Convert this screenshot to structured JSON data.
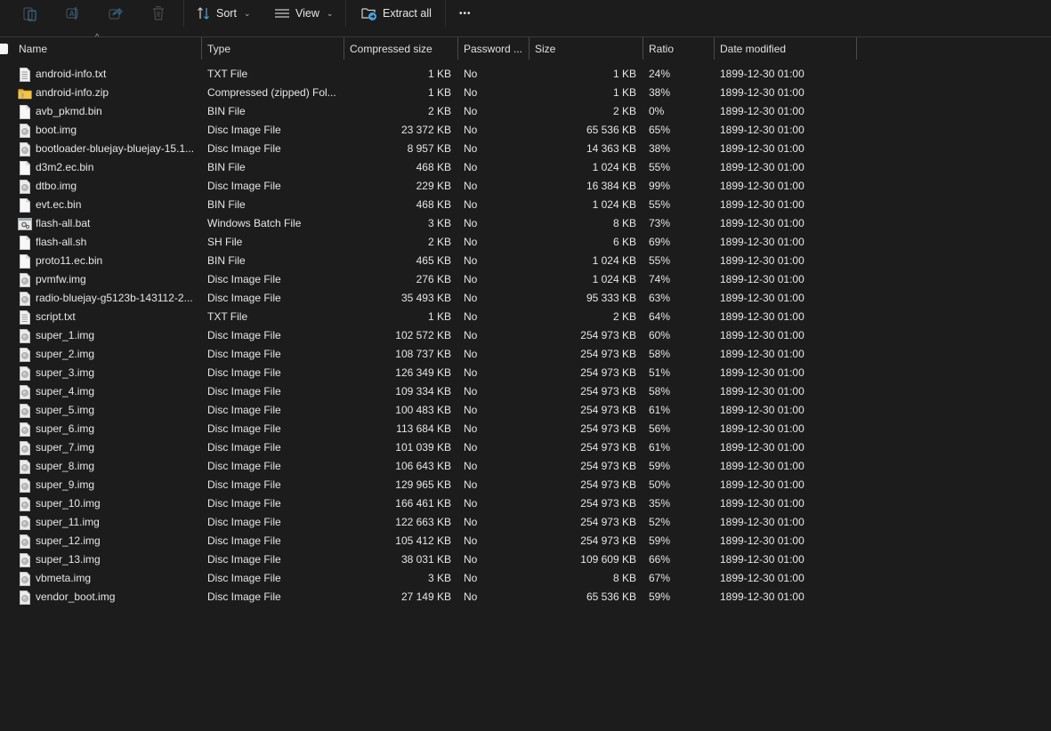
{
  "toolbar": {
    "icons": [
      {
        "name": "copy-icon",
        "label": "Copy"
      },
      {
        "name": "rename-icon",
        "label": "Rename"
      },
      {
        "name": "share-icon",
        "label": "Share"
      },
      {
        "name": "delete-icon",
        "label": "Delete"
      }
    ],
    "sort_label": "Sort",
    "view_label": "View",
    "extract_label": "Extract all",
    "more_label": "•••",
    "accent_color": "#4aa3df"
  },
  "columns": {
    "name": "Name",
    "type": "Type",
    "compressed": "Compressed size",
    "password": "Password ...",
    "size": "Size",
    "ratio": "Ratio",
    "date": "Date modified",
    "sort_indicator": "^"
  },
  "files": [
    {
      "icon": "text-file-icon",
      "name": "android-info.txt",
      "type": "TXT File",
      "compressed": "1 KB",
      "password": "No",
      "size": "1 KB",
      "ratio": "24%",
      "date": "1899-12-30 01:00"
    },
    {
      "icon": "zip-folder-icon",
      "name": "android-info.zip",
      "type": "Compressed (zipped) Fol...",
      "compressed": "1 KB",
      "password": "No",
      "size": "1 KB",
      "ratio": "38%",
      "date": "1899-12-30 01:00"
    },
    {
      "icon": "blank-file-icon",
      "name": "avb_pkmd.bin",
      "type": "BIN File",
      "compressed": "2 KB",
      "password": "No",
      "size": "2 KB",
      "ratio": "0%",
      "date": "1899-12-30 01:00"
    },
    {
      "icon": "disc-image-icon",
      "name": "boot.img",
      "type": "Disc Image File",
      "compressed": "23 372 KB",
      "password": "No",
      "size": "65 536 KB",
      "ratio": "65%",
      "date": "1899-12-30 01:00"
    },
    {
      "icon": "disc-image-icon",
      "name": "bootloader-bluejay-bluejay-15.1...",
      "type": "Disc Image File",
      "compressed": "8 957 KB",
      "password": "No",
      "size": "14 363 KB",
      "ratio": "38%",
      "date": "1899-12-30 01:00"
    },
    {
      "icon": "blank-file-icon",
      "name": "d3m2.ec.bin",
      "type": "BIN File",
      "compressed": "468 KB",
      "password": "No",
      "size": "1 024 KB",
      "ratio": "55%",
      "date": "1899-12-30 01:00"
    },
    {
      "icon": "disc-image-icon",
      "name": "dtbo.img",
      "type": "Disc Image File",
      "compressed": "229 KB",
      "password": "No",
      "size": "16 384 KB",
      "ratio": "99%",
      "date": "1899-12-30 01:00"
    },
    {
      "icon": "blank-file-icon",
      "name": "evt.ec.bin",
      "type": "BIN File",
      "compressed": "468 KB",
      "password": "No",
      "size": "1 024 KB",
      "ratio": "55%",
      "date": "1899-12-30 01:00"
    },
    {
      "icon": "batch-file-icon",
      "name": "flash-all.bat",
      "type": "Windows Batch File",
      "compressed": "3 KB",
      "password": "No",
      "size": "8 KB",
      "ratio": "73%",
      "date": "1899-12-30 01:00"
    },
    {
      "icon": "blank-file-icon",
      "name": "flash-all.sh",
      "type": "SH File",
      "compressed": "2 KB",
      "password": "No",
      "size": "6 KB",
      "ratio": "69%",
      "date": "1899-12-30 01:00"
    },
    {
      "icon": "blank-file-icon",
      "name": "proto11.ec.bin",
      "type": "BIN File",
      "compressed": "465 KB",
      "password": "No",
      "size": "1 024 KB",
      "ratio": "55%",
      "date": "1899-12-30 01:00"
    },
    {
      "icon": "disc-image-icon",
      "name": "pvmfw.img",
      "type": "Disc Image File",
      "compressed": "276 KB",
      "password": "No",
      "size": "1 024 KB",
      "ratio": "74%",
      "date": "1899-12-30 01:00"
    },
    {
      "icon": "disc-image-icon",
      "name": "radio-bluejay-g5123b-143112-2...",
      "type": "Disc Image File",
      "compressed": "35 493 KB",
      "password": "No",
      "size": "95 333 KB",
      "ratio": "63%",
      "date": "1899-12-30 01:00"
    },
    {
      "icon": "text-file-icon",
      "name": "script.txt",
      "type": "TXT File",
      "compressed": "1 KB",
      "password": "No",
      "size": "2 KB",
      "ratio": "64%",
      "date": "1899-12-30 01:00"
    },
    {
      "icon": "disc-image-icon",
      "name": "super_1.img",
      "type": "Disc Image File",
      "compressed": "102 572 KB",
      "password": "No",
      "size": "254 973 KB",
      "ratio": "60%",
      "date": "1899-12-30 01:00"
    },
    {
      "icon": "disc-image-icon",
      "name": "super_2.img",
      "type": "Disc Image File",
      "compressed": "108 737 KB",
      "password": "No",
      "size": "254 973 KB",
      "ratio": "58%",
      "date": "1899-12-30 01:00"
    },
    {
      "icon": "disc-image-icon",
      "name": "super_3.img",
      "type": "Disc Image File",
      "compressed": "126 349 KB",
      "password": "No",
      "size": "254 973 KB",
      "ratio": "51%",
      "date": "1899-12-30 01:00"
    },
    {
      "icon": "disc-image-icon",
      "name": "super_4.img",
      "type": "Disc Image File",
      "compressed": "109 334 KB",
      "password": "No",
      "size": "254 973 KB",
      "ratio": "58%",
      "date": "1899-12-30 01:00"
    },
    {
      "icon": "disc-image-icon",
      "name": "super_5.img",
      "type": "Disc Image File",
      "compressed": "100 483 KB",
      "password": "No",
      "size": "254 973 KB",
      "ratio": "61%",
      "date": "1899-12-30 01:00"
    },
    {
      "icon": "disc-image-icon",
      "name": "super_6.img",
      "type": "Disc Image File",
      "compressed": "113 684 KB",
      "password": "No",
      "size": "254 973 KB",
      "ratio": "56%",
      "date": "1899-12-30 01:00"
    },
    {
      "icon": "disc-image-icon",
      "name": "super_7.img",
      "type": "Disc Image File",
      "compressed": "101 039 KB",
      "password": "No",
      "size": "254 973 KB",
      "ratio": "61%",
      "date": "1899-12-30 01:00"
    },
    {
      "icon": "disc-image-icon",
      "name": "super_8.img",
      "type": "Disc Image File",
      "compressed": "106 643 KB",
      "password": "No",
      "size": "254 973 KB",
      "ratio": "59%",
      "date": "1899-12-30 01:00"
    },
    {
      "icon": "disc-image-icon",
      "name": "super_9.img",
      "type": "Disc Image File",
      "compressed": "129 965 KB",
      "password": "No",
      "size": "254 973 KB",
      "ratio": "50%",
      "date": "1899-12-30 01:00"
    },
    {
      "icon": "disc-image-icon",
      "name": "super_10.img",
      "type": "Disc Image File",
      "compressed": "166 461 KB",
      "password": "No",
      "size": "254 973 KB",
      "ratio": "35%",
      "date": "1899-12-30 01:00"
    },
    {
      "icon": "disc-image-icon",
      "name": "super_11.img",
      "type": "Disc Image File",
      "compressed": "122 663 KB",
      "password": "No",
      "size": "254 973 KB",
      "ratio": "52%",
      "date": "1899-12-30 01:00"
    },
    {
      "icon": "disc-image-icon",
      "name": "super_12.img",
      "type": "Disc Image File",
      "compressed": "105 412 KB",
      "password": "No",
      "size": "254 973 KB",
      "ratio": "59%",
      "date": "1899-12-30 01:00"
    },
    {
      "icon": "disc-image-icon",
      "name": "super_13.img",
      "type": "Disc Image File",
      "compressed": "38 031 KB",
      "password": "No",
      "size": "109 609 KB",
      "ratio": "66%",
      "date": "1899-12-30 01:00"
    },
    {
      "icon": "disc-image-icon",
      "name": "vbmeta.img",
      "type": "Disc Image File",
      "compressed": "3 KB",
      "password": "No",
      "size": "8 KB",
      "ratio": "67%",
      "date": "1899-12-30 01:00"
    },
    {
      "icon": "disc-image-icon",
      "name": "vendor_boot.img",
      "type": "Disc Image File",
      "compressed": "27 149 KB",
      "password": "No",
      "size": "65 536 KB",
      "ratio": "59%",
      "date": "1899-12-30 01:00"
    }
  ]
}
